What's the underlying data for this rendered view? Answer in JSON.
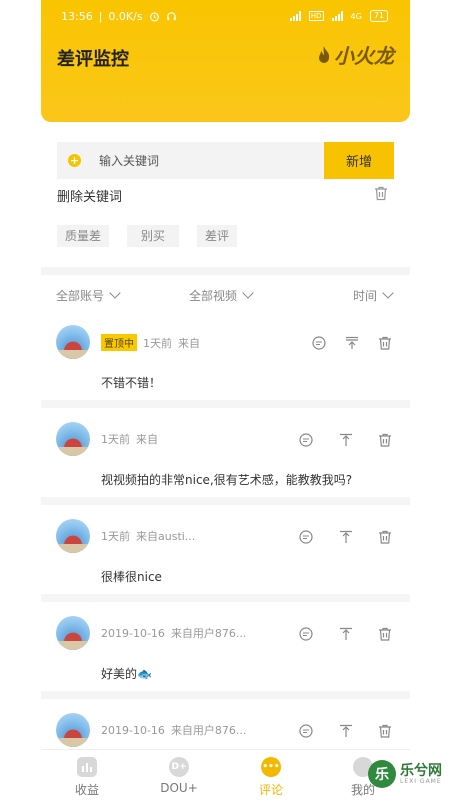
{
  "status_bar": {
    "time": "13:56",
    "network_speed": "0.0K/s",
    "network_type_1": "HD",
    "network_type_2": "4G",
    "battery": "71"
  },
  "header": {
    "title": "差评监控",
    "logo_text": "小火龙"
  },
  "keyword_panel": {
    "input_placeholder": "输入关键词",
    "add_label": "新增",
    "delete_label": "删除关键词",
    "tags": [
      "质量差",
      "别买",
      "差评"
    ]
  },
  "filters": {
    "account": "全部账号",
    "video": "全部视频",
    "time": "时间"
  },
  "comments": [
    {
      "pinned": true,
      "pin_label": "置顶中",
      "time": "1天前",
      "source": "来自",
      "text": "不错不错！"
    },
    {
      "pinned": false,
      "time": "1天前",
      "source": "来自",
      "text": "视视频拍的非常nice,很有艺术感，能教教我吗?"
    },
    {
      "pinned": false,
      "time": "1天前",
      "source": "来自austi...",
      "text": "很棒很nice"
    },
    {
      "pinned": false,
      "time": "2019-10-16",
      "source": "来自用户876...",
      "text": "好美的🐟"
    },
    {
      "pinned": false,
      "time": "2019-10-16",
      "source": "来自用户876...",
      "text": ""
    }
  ],
  "tabbar": {
    "items": [
      {
        "label": "收益",
        "icon": "bar-chart-icon"
      },
      {
        "label": "DOU+",
        "icon": "dou-plus-icon"
      },
      {
        "label": "评论",
        "icon": "comment-icon",
        "active": true
      },
      {
        "label": "我的",
        "icon": "profile-icon"
      }
    ]
  },
  "watermark": {
    "text": "乐兮网",
    "sub": "LEXI GAME"
  },
  "colors": {
    "accent": "#f7c300",
    "header_bg": "#fbc61a"
  }
}
